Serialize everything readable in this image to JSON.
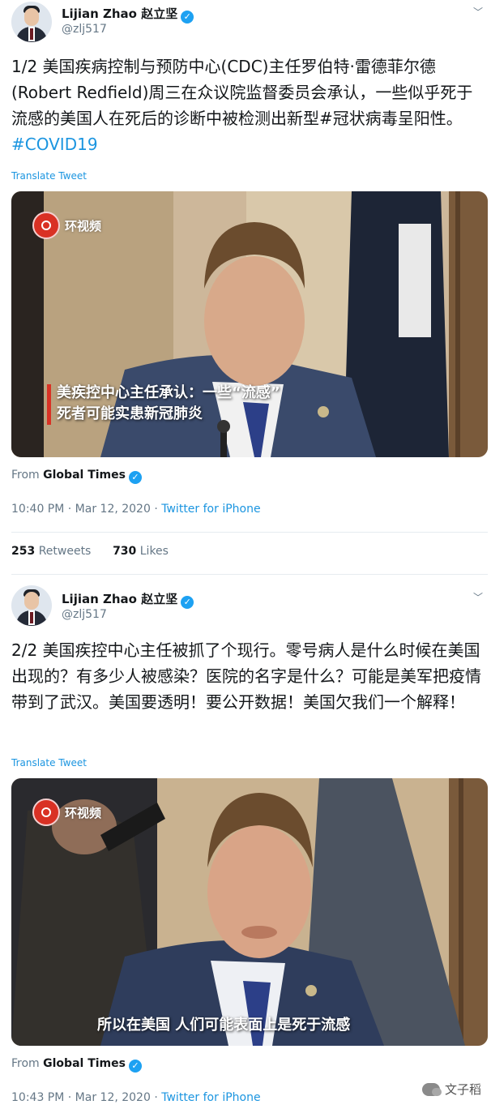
{
  "tweets": [
    {
      "author": "Lijian Zhao 赵立坚",
      "handle": "@zlj517",
      "text": "1/2 美国疾病控制与预防中心(CDC)主任罗伯特·雷德菲尔德(Robert Redfield)周三在众议院监督委员会承认，一些似乎死于流感的美国人在死后的诊断中被检测出新型#冠状病毒呈阳性。",
      "hashtag": "#COVID19",
      "translate": "Translate Tweet",
      "media_logo": "环视频",
      "subtitle_line1": "美疾控中心主任承认：一些“流感”",
      "subtitle_line2": "死者可能实患新冠肺炎",
      "from_prefix": "From",
      "from_source": "Global Times",
      "time": "10:40 PM · Mar 12, 2020",
      "via": "Twitter for iPhone",
      "retweets_count": "253",
      "retweets_label": "Retweets",
      "likes_count": "730",
      "likes_label": "Likes"
    },
    {
      "author": "Lijian Zhao 赵立坚",
      "handle": "@zlj517",
      "text": "2/2 美国疾控中心主任被抓了个现行。零号病人是什么时候在美国出现的？有多少人被感染？医院的名字是什么？可能是美军把疫情带到了武汉。美国要透明！要公开数据！美国欠我们一个解释！",
      "translate": "Translate Tweet",
      "media_logo": "环视频",
      "subtitle": "所以在美国 人们可能表面上是死于流感",
      "from_prefix": "From",
      "from_source": "Global Times",
      "time": "10:43 PM · Mar 12, 2020",
      "via": "Twitter for iPhone"
    }
  ],
  "watermark": "文子稻",
  "icons": {
    "verified": "verified-badge-icon",
    "more": "chevron-down-icon",
    "logo": "huanshipin-logo-icon"
  },
  "colors": {
    "link": "#1b95e0",
    "verified": "#1da1f2",
    "muted": "#657786",
    "logo_red": "#d93124"
  }
}
